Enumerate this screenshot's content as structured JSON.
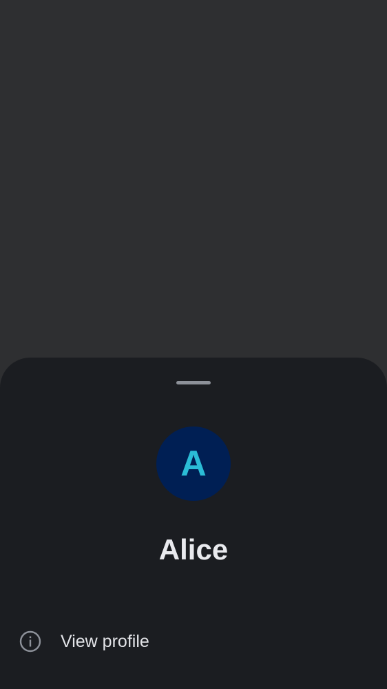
{
  "sheet": {
    "avatar": {
      "initial": "A",
      "background_color": "#001f54",
      "letter_color": "#2bbcd6"
    },
    "contact_name": "Alice",
    "menu": [
      {
        "label": "View profile",
        "icon": "info-icon"
      }
    ]
  },
  "colors": {
    "scrim": "#2e2f31",
    "sheet_background": "#1b1d21",
    "drag_handle": "#8d9199",
    "text_primary": "#e9eaee"
  }
}
